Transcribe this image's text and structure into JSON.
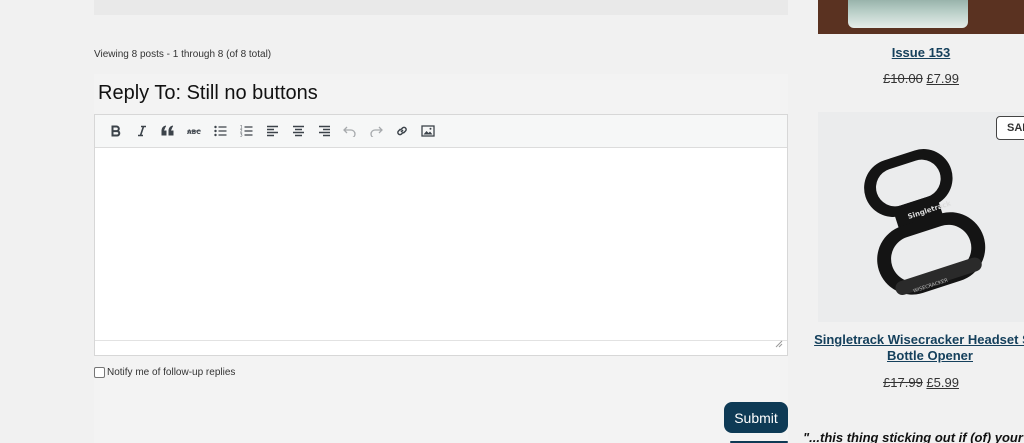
{
  "topic": {
    "viewing_text": "Viewing 8 posts - 1 through 8 (of 8 total)",
    "reply_title": "Reply To: Still no buttons"
  },
  "editor": {
    "toolbar": [
      {
        "name": "bold-icon",
        "title": "Bold"
      },
      {
        "name": "italic-icon",
        "title": "Italic"
      },
      {
        "name": "blockquote-icon",
        "title": "Blockquote"
      },
      {
        "name": "strikethrough-icon",
        "title": "Strikethrough"
      },
      {
        "name": "bullet-list-icon",
        "title": "Bulleted list"
      },
      {
        "name": "numbered-list-icon",
        "title": "Numbered list"
      },
      {
        "name": "align-left-icon",
        "title": "Align left"
      },
      {
        "name": "align-center-icon",
        "title": "Align center"
      },
      {
        "name": "align-right-icon",
        "title": "Align right"
      },
      {
        "name": "undo-icon",
        "title": "Undo"
      },
      {
        "name": "redo-icon",
        "title": "Redo"
      },
      {
        "name": "link-icon",
        "title": "Insert link"
      },
      {
        "name": "image-icon",
        "title": "Insert image"
      }
    ],
    "body": ""
  },
  "form": {
    "notify_label": "Notify me of follow-up replies",
    "notify_checked": false,
    "submit_label": "Submit"
  },
  "sidebar": {
    "product1": {
      "title": "Issue 153",
      "old_price": "£10.00",
      "price": "£7.99"
    },
    "product2": {
      "badge": "SAL",
      "title_line1": "Singletrack Wisecracker Headset Spa",
      "title_line2": "Bottle Opener",
      "old_price": "£17.99",
      "price": "£5.99",
      "product_marking_top": "Singletrack",
      "product_marking_bottom": "WISECRACKER"
    },
    "quote": "\"...this thing sticking out if (of)  your"
  },
  "colors": {
    "accent": "#0e3a55",
    "link": "#15405c",
    "page_bg": "#f1f1f1"
  }
}
